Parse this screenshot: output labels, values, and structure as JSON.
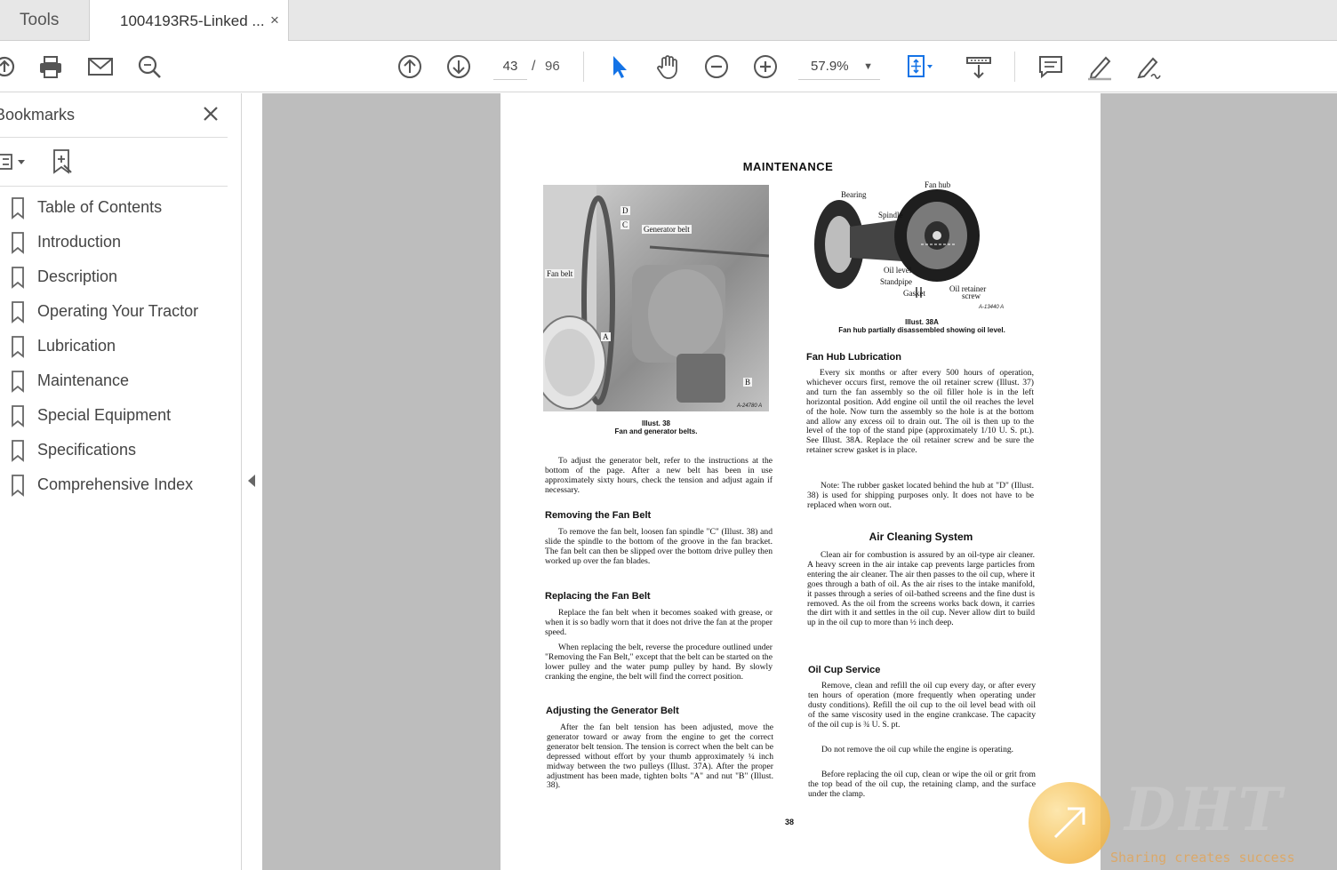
{
  "tabs": {
    "tools_label": "Tools",
    "document_label": "1004193R5-Linked ...",
    "close_glyph": "×"
  },
  "toolbar": {
    "icons": [
      "upload-icon",
      "print-icon",
      "email-icon",
      "search-icon",
      "previous-page-icon",
      "next-page-icon",
      "select-cursor-icon",
      "hand-icon",
      "zoom-out-icon",
      "zoom-in-icon",
      "fit-page-icon",
      "scroll-mode-icon",
      "comment-icon",
      "highlight-icon",
      "sign-icon"
    ],
    "current_page": "43",
    "page_separator": "/",
    "total_pages": "96",
    "zoom": "57.9%",
    "accent_color": "#1473e6"
  },
  "bookmarks": {
    "title": "Bookmarks",
    "items": [
      {
        "label": "Table of Contents"
      },
      {
        "label": "Introduction"
      },
      {
        "label": "Description"
      },
      {
        "label": "Operating Your Tractor"
      },
      {
        "label": "Lubrication"
      },
      {
        "label": "Maintenance"
      },
      {
        "label": "Special Equipment"
      },
      {
        "label": "Specifications"
      },
      {
        "label": "Comprehensive Index"
      }
    ]
  },
  "document": {
    "heading": "MAINTENANCE",
    "photo_labels": {
      "d": "D",
      "c": "C",
      "generator_belt": "Generator belt",
      "fan_belt": "Fan belt",
      "a": "A",
      "b": "B",
      "code": "A-24780 A"
    },
    "illust_38_caption": {
      "title": "Illust. 38",
      "text": "Fan and generator belts."
    },
    "hub_labels": {
      "fan_hub": "Fan hub",
      "bearing": "Bearing",
      "spindle": "Spindle",
      "oil_level": "Oil level",
      "standpipe": "Standpipe",
      "gasket": "Gasket",
      "oil_retainer_1": "Oil retainer",
      "oil_retainer_2": "screw",
      "code": "A-13440 A"
    },
    "illust_38a_caption": {
      "title": "Illust. 38A",
      "text": "Fan hub partially disassembled showing oil level."
    },
    "left_col": {
      "intro": "To adjust the generator belt, refer to the instructions at the bottom of the page. After a new belt has been in use approximately sixty hours, check the tension and adjust again if necessary.",
      "removing_heading": "Removing the Fan Belt",
      "removing_text": "To remove the fan belt, loosen fan spindle \"C\" (Illust. 38) and slide the spindle to the bottom of the groove in the fan bracket. The fan belt can then be slipped over the bottom drive pulley then worked up over the fan blades.",
      "replacing_heading": "Replacing the Fan Belt",
      "replacing_text_1": "Replace the fan belt when it becomes soaked with grease, or when it is so badly worn that it does not drive the fan at the proper speed.",
      "replacing_text_2": "When replacing the belt, reverse the procedure outlined under \"Removing the Fan Belt,\" except that the belt can be started on the lower pulley and the water pump pulley by hand. By slowly cranking the engine, the belt will find the correct position.",
      "adjusting_heading": "Adjusting the Generator Belt",
      "adjusting_text": "After the fan belt tension has been adjusted, move the generator toward or away from the engine to get the correct generator belt tension. The tension is correct when the belt can be depressed without effort by your thumb approximately ¼ inch midway between the two pulleys (Illust. 37A). After the proper adjustment has been made, tighten bolts \"A\" and nut \"B\" (Illust. 38)."
    },
    "right_col": {
      "fan_hub_heading": "Fan Hub Lubrication",
      "fan_hub_text": "Every six months or after every 500 hours of operation, whichever occurs first, remove the oil retainer screw (Illust. 37) and turn the fan assembly so the oil filler hole is in the left horizontal position. Add engine oil until the oil reaches the level of the hole. Now turn the assembly so the hole is at the bottom and allow any excess oil to drain out. The oil is then up to the level of the top of the stand pipe (approximately 1/10 U. S. pt.). See Illust. 38A. Replace the oil retainer screw and be sure the retainer screw gasket is in place.",
      "note_text": "Note: The rubber gasket located behind the hub at \"D\" (Illust. 38) is used for shipping purposes only. It does not have to be replaced when worn out.",
      "air_heading": "Air Cleaning System",
      "air_text": "Clean air for combustion is assured by an oil-type air cleaner. A heavy screen in the air intake cap prevents large particles from entering the air cleaner. The air then passes to the oil cup, where it goes through a bath of oil. As the air rises to the intake manifold, it passes through a series of oil-bathed screens and the fine dust is removed. As the oil from the screens works back down, it carries the dirt with it and settles in the oil cup. Never allow dirt to build up in the oil cup to more than ½ inch deep.",
      "oil_cup_heading": "Oil Cup Service",
      "oil_cup_text_1": "Remove, clean and refill the oil cup every day, or after every ten hours of operation (more frequently when operating under dusty conditions). Refill the oil cup to the oil level bead with oil of the same viscosity used in the engine crankcase. The capacity of the oil cup is ¾ U. S. pt.",
      "oil_cup_text_2": "Do not remove the oil cup while the engine is operating.",
      "oil_cup_text_3": "Before replacing the oil cup, clean or wipe the oil or grit from the top bead of the oil cup, the retaining clamp, and the surface under the clamp."
    },
    "page_number": "38"
  },
  "watermark": {
    "brand": "DHT",
    "slogan": "Sharing creates success"
  }
}
